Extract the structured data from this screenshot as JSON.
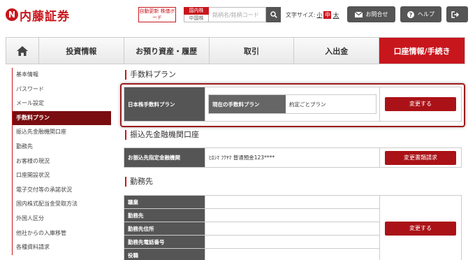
{
  "header": {
    "logo_text": "内藤証券",
    "auto_update": "自動更新 株価ボード",
    "market_label": "国内株",
    "market_sub": "中国株",
    "search_placeholder": "銘柄名/銘柄コード",
    "fontsize_label": "文字サイズ:",
    "fontsize_small": "小",
    "fontsize_mid": "中",
    "fontsize_large": "太",
    "contact_label": "お問合せ",
    "help_label": "ヘルプ"
  },
  "nav": {
    "items": [
      "投資情報",
      "お預り資産・履歴",
      "取引",
      "入出金",
      "口座情報/手続き"
    ]
  },
  "sidebar": {
    "items": [
      "基本情報",
      "パスワード",
      "メール設定",
      "手数料プラン",
      "振込先金融機関口座",
      "勤務先",
      "お客様の現況",
      "口座開設状況",
      "電子交付等の承諾状況",
      "国内株式配当金受取方法",
      "外国人区分",
      "他社からの入庫移管",
      "各種資料請求"
    ],
    "active_index": 3
  },
  "fee": {
    "title": "手数料プラン",
    "row_label": "日本株手数料プラン",
    "current_label": "現在の手数料プラン",
    "current_value": "約定ごとプラン",
    "change_button": "変更する"
  },
  "bank": {
    "title": "振込先金融機関口座",
    "row_label": "お振込先指定金融機関",
    "value": "ﾋﾛｼﾏ ﾌｸﾔﾏ 普通預金123****",
    "button": "変更書類請求"
  },
  "work": {
    "title": "勤務先",
    "labels": [
      "職業",
      "勤務先",
      "勤務先住所",
      "勤務先電話番号",
      "役職"
    ],
    "button": "変更する"
  },
  "colors": {
    "accent": "#c8161d",
    "dark_red": "#7a0d10",
    "header_cell": "#555555"
  }
}
